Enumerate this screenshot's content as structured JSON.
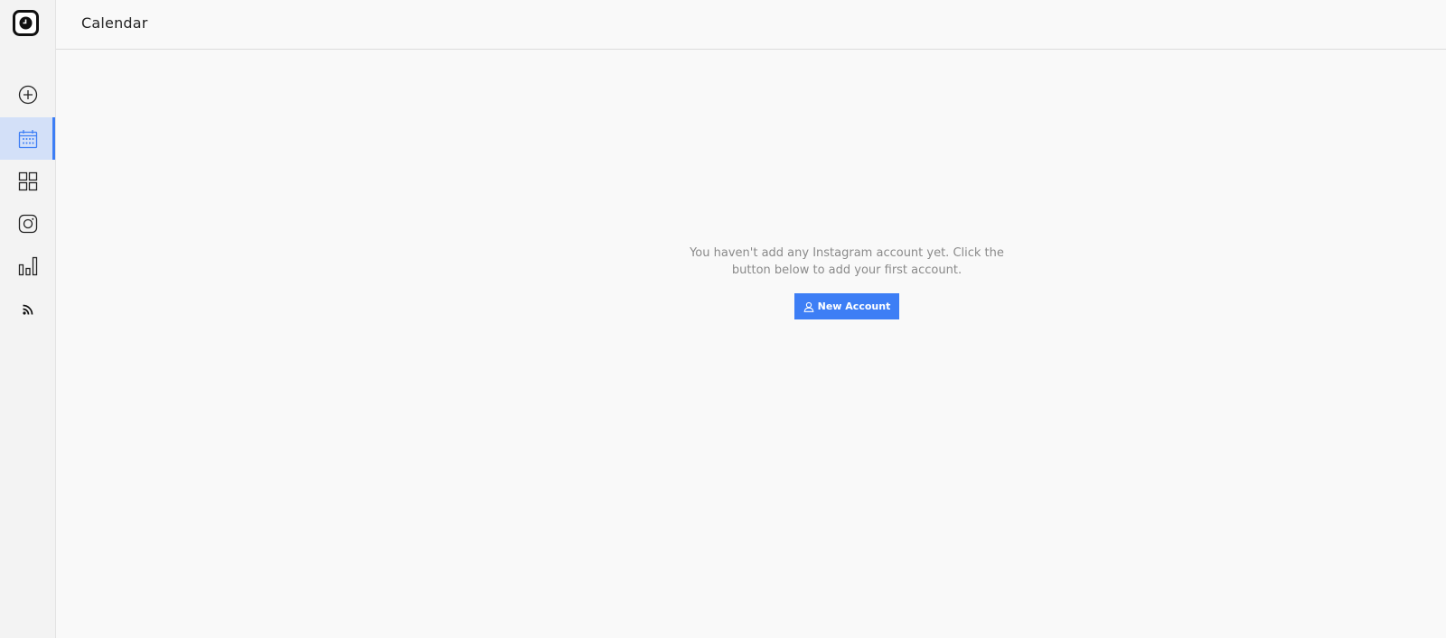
{
  "header": {
    "title": "Calendar"
  },
  "sidebar": {
    "logo_icon": "clock-logo-icon",
    "items": [
      {
        "id": "new-post",
        "icon": "plus-circle-icon",
        "active": false
      },
      {
        "id": "calendar",
        "icon": "calendar-icon",
        "active": true
      },
      {
        "id": "dashboard",
        "icon": "grid-icon",
        "active": false
      },
      {
        "id": "instagram",
        "icon": "instagram-icon",
        "active": false
      },
      {
        "id": "analytics",
        "icon": "bar-chart-icon",
        "active": false
      },
      {
        "id": "rss",
        "icon": "rss-icon",
        "active": false
      }
    ]
  },
  "empty_state": {
    "message": "You haven't add any Instagram account yet. Click the button below to add your first account.",
    "button_label": "New Account",
    "button_icon": "user-icon"
  },
  "colors": {
    "accent": "#3d7ef5",
    "active_bg": "#d3e0f8",
    "sidebar_bg": "#f3f3f3",
    "page_bg": "#f9f9f9"
  }
}
